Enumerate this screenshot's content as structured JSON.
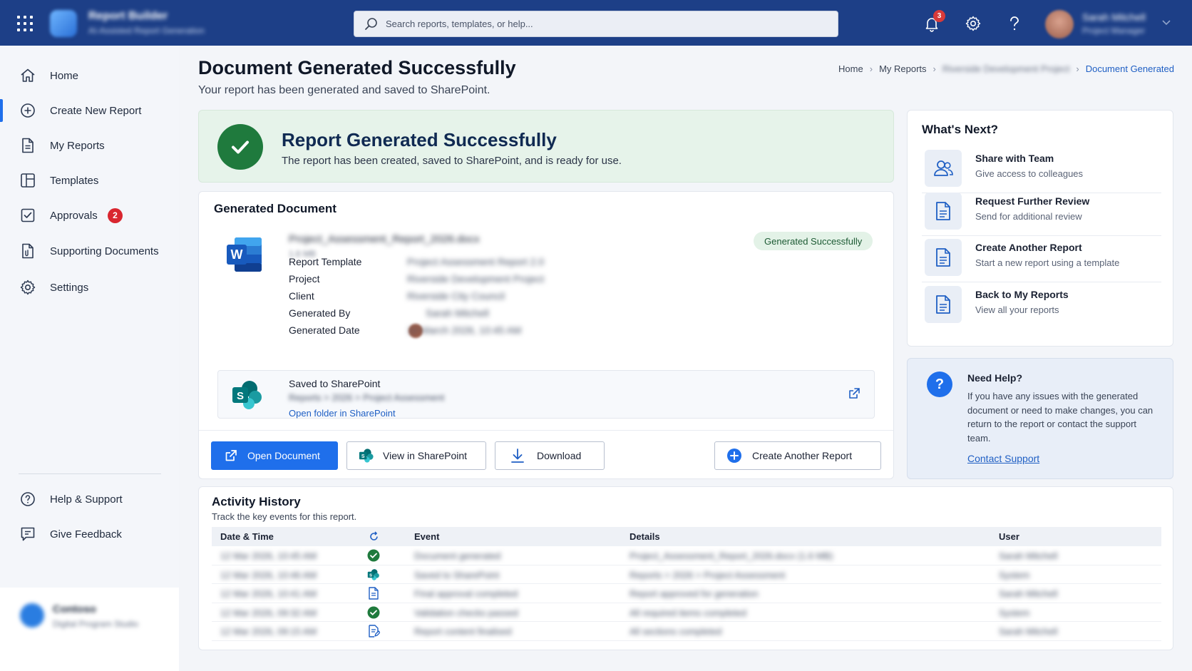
{
  "topbar": {
    "app_name": "Report Builder",
    "app_subtitle": "AI-Assisted Report Generation",
    "search_placeholder": "Search reports, templates, or help...",
    "notification_count": "3",
    "user_name": "Sarah Mitchell",
    "user_role": "Project Manager"
  },
  "sidebar": {
    "items": [
      {
        "label": "Home",
        "icon": "home-icon"
      },
      {
        "label": "Create New Report",
        "icon": "plus-circle-icon"
      },
      {
        "label": "My Reports",
        "icon": "document-icon"
      },
      {
        "label": "Templates",
        "icon": "template-icon"
      },
      {
        "label": "Approvals",
        "icon": "approval-check-icon",
        "badge": "2"
      },
      {
        "label": "Supporting Documents",
        "icon": "attachment-document-icon"
      },
      {
        "label": "Settings",
        "icon": "gear-icon"
      }
    ],
    "bottom_items": [
      {
        "label": "Help & Support",
        "icon": "help-circle-icon"
      },
      {
        "label": "Give Feedback",
        "icon": "feedback-icon"
      }
    ],
    "tenant": {
      "name": "Contoso",
      "subtitle": "Digital Program Studio"
    }
  },
  "header": {
    "title": "Document Generated Successfully",
    "subtitle": "Your report has been generated and saved to SharePoint.",
    "breadcrumb": [
      "Home",
      "My Reports",
      "Riverside Development Project",
      "Document Generated"
    ]
  },
  "banner": {
    "title": "Report Generated Successfully",
    "text": "The report has been created, saved to SharePoint, and is ready for use."
  },
  "document": {
    "section_title": "Generated Document",
    "file_name": "Project_Assessment_Report_2026.docx",
    "file_size": "1.6 MB",
    "status": "Generated Successfully",
    "meta": [
      {
        "label": "Report Template",
        "value": "Project Assessment Report 2.0"
      },
      {
        "label": "Project",
        "value": "Riverside Development Project"
      },
      {
        "label": "Client",
        "value": "Riverside City Council"
      },
      {
        "label": "Generated By",
        "value": "Sarah Mitchell"
      },
      {
        "label": "Generated Date",
        "value": "12 March 2026, 10:45 AM"
      }
    ],
    "sharepoint": {
      "title": "Saved to SharePoint",
      "path": "Reports > 2026 > Project Assessment",
      "link": "Open folder in SharePoint"
    },
    "actions": {
      "open": "Open Document",
      "view_sp": "View in SharePoint",
      "download": "Download",
      "create": "Create Another Report"
    }
  },
  "whats_next": {
    "title": "What's Next?",
    "items": [
      {
        "title": "Share with Team",
        "desc": "Give access to colleagues",
        "icon": "people-icon"
      },
      {
        "title": "Request Further Review",
        "desc": "Send for additional review",
        "icon": "document-review-icon"
      },
      {
        "title": "Create Another Report",
        "desc": "Start a new report using a template",
        "icon": "document-new-icon"
      },
      {
        "title": "Back to My Reports",
        "desc": "View all your reports",
        "icon": "document-list-icon"
      }
    ]
  },
  "help": {
    "title": "Need Help?",
    "text": "If you have any issues with the generated document or need to make changes, you can return to the report or contact the support team.",
    "link": "Contact Support"
  },
  "activity": {
    "title": "Activity History",
    "subtitle": "Track the key events for this report.",
    "columns": [
      "Date & Time",
      "Event",
      "Details",
      "User"
    ],
    "rows": [
      {
        "date": "12 Mar 2026, 10:45 AM",
        "icon": "check-circle-icon",
        "event": "Document generated",
        "details": "Project_Assessment_Report_2026.docx (1.6 MB)",
        "user": "Sarah Mitchell"
      },
      {
        "date": "12 Mar 2026, 10:46 AM",
        "icon": "sharepoint-icon",
        "event": "Saved to SharePoint",
        "details": "Reports > 2026 > Project Assessment",
        "user": "System"
      },
      {
        "date": "12 Mar 2026, 10:41 AM",
        "icon": "document-icon",
        "event": "Final approval completed",
        "details": "Report approved for generation",
        "user": "Sarah Mitchell"
      },
      {
        "date": "12 Mar 2026, 09:32 AM",
        "icon": "check-circle-icon",
        "event": "Validation checks passed",
        "details": "All required items completed",
        "user": "System"
      },
      {
        "date": "12 Mar 2026, 09:15 AM",
        "icon": "document-edit-icon",
        "event": "Report content finalised",
        "details": "All sections completed",
        "user": "Sarah Mitchell"
      }
    ]
  },
  "colors": {
    "primary": "#1f6feb",
    "topbar": "#1d3f87",
    "success": "#1f7a3d",
    "badge": "#d9262f"
  }
}
